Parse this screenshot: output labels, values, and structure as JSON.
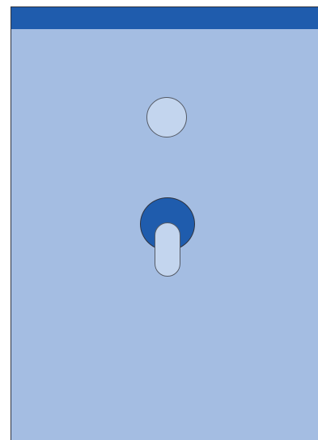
{
  "colors": {
    "page_background": "#ffffff",
    "panel_fill": "#a4bde2",
    "panel_border": "#2f3440",
    "top_bar_fill": "#1f5cad",
    "light_fill": "#c3d5ee",
    "light_stroke": "#555b66",
    "switch_base_fill": "#1f5cad"
  },
  "shapes": {
    "top_circle": "circle",
    "switch_base": "circle",
    "switch_lever": "rounded-rectangle"
  }
}
